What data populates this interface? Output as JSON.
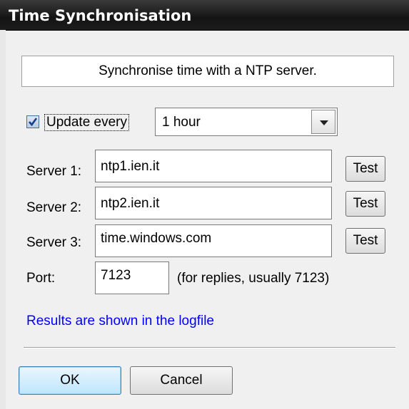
{
  "window": {
    "title": "Time Synchronisation"
  },
  "banner": {
    "text": "Synchronise time with a NTP server."
  },
  "update": {
    "checked": true,
    "label": "Update every",
    "interval": "1 hour"
  },
  "servers": [
    {
      "label": "Server 1:",
      "value": "ntp1.ien.it",
      "test_label": "Test"
    },
    {
      "label": "Server 2:",
      "value": "ntp2.ien.it",
      "test_label": "Test"
    },
    {
      "label": "Server 3:",
      "value": "time.windows.com",
      "test_label": "Test"
    }
  ],
  "port": {
    "label": "Port:",
    "value": "7123",
    "note": "(for replies, usually 7123)"
  },
  "results_link": "Results are shown in the logfile",
  "buttons": {
    "ok": "OK",
    "cancel": "Cancel"
  },
  "colors": {
    "titlebar": "#1c1c1c",
    "link": "#0000ff",
    "checkbox_check": "#1a3f8a"
  }
}
